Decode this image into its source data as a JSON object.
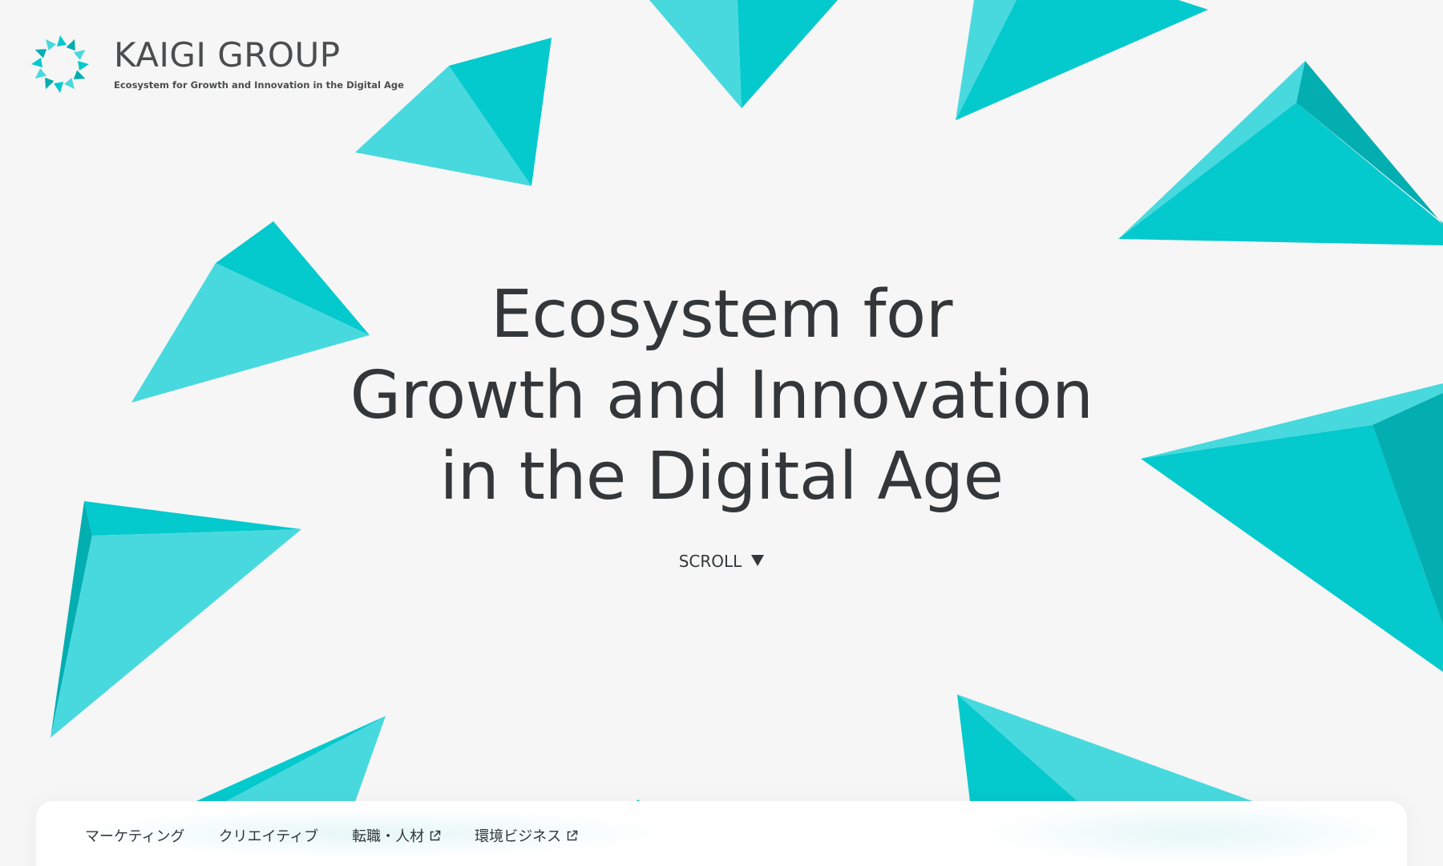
{
  "brand": {
    "name": "KAIGI GROUP",
    "tagline": "Ecosystem for Growth and Innovation in the Digital Age"
  },
  "hero": {
    "lines": [
      "Ecosystem for",
      "Growth and Innovation",
      "in the Digital Age"
    ]
  },
  "scroll": {
    "label": "SCROLL",
    "icon": "triangle-down-icon"
  },
  "nav": {
    "items": [
      {
        "label": "マーケティング",
        "external": false
      },
      {
        "label": "クリエイティブ",
        "external": false
      },
      {
        "label": "転職・人材",
        "external": true,
        "icon": "external-link-icon"
      },
      {
        "label": "環境ビジネス",
        "external": true,
        "icon": "external-link-icon"
      }
    ]
  },
  "colors": {
    "background": "#f6f6f6",
    "teal": "#04c9cd",
    "teal_light": "#48d9de",
    "teal_dark": "#03aeb1",
    "text": "#333739",
    "logo_accent": "#f0a020"
  }
}
